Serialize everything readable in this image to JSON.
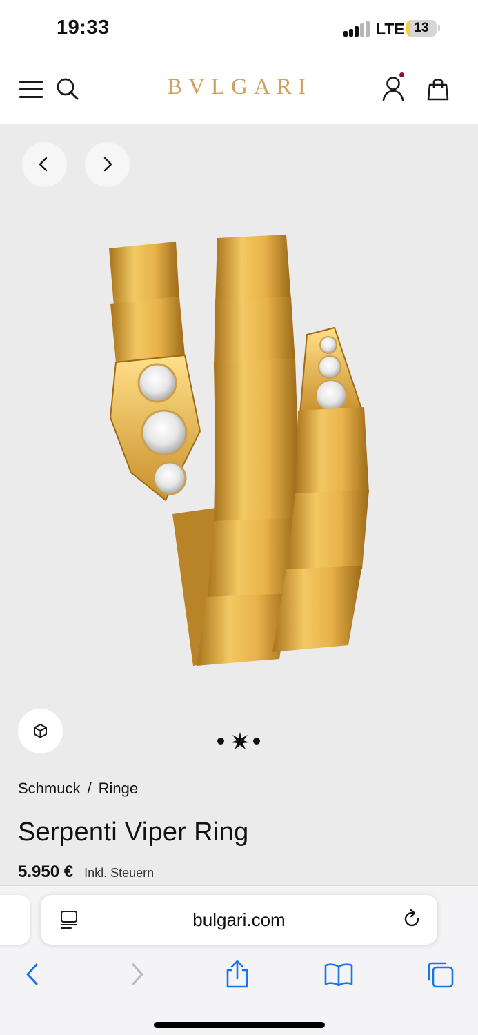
{
  "status_bar": {
    "time": "19:33",
    "network": "LTE",
    "battery_level": "13",
    "battery_fraction": 0.13,
    "battery_color": "#f6cf3a"
  },
  "header": {
    "logo": "BVLGARI",
    "logo_color": "#cfa160",
    "icons": [
      "menu-icon",
      "search-icon",
      "account-icon",
      "shopping-bag-icon"
    ],
    "account_badge_color": "#8a1538"
  },
  "gallery": {
    "icons": [
      "chevron-left-icon",
      "chevron-right-icon",
      "cube-3d-icon"
    ],
    "slide_count": 3,
    "active_slide": 2,
    "active_indicator": "sparkle-icon"
  },
  "product": {
    "breadcrumb": {
      "category": "Schmuck",
      "separator": "/",
      "subcategory": "Ringe"
    },
    "title": "Serpenti Viper Ring",
    "price": "5.950 €",
    "tax_note": "Inkl. Steuern"
  },
  "browser": {
    "url": "bulgari.com",
    "accent_color": "#1a73e8",
    "toolbar_icons": [
      "back-icon",
      "forward-icon",
      "share-icon",
      "bookmarks-icon",
      "tabs-icon"
    ]
  }
}
